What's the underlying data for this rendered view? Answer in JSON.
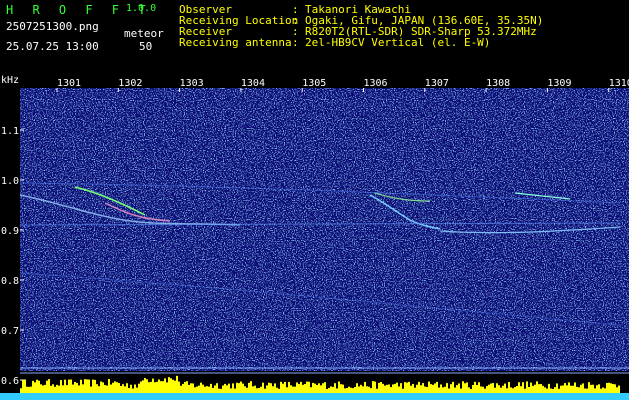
{
  "header": {
    "app_title": "H R O F F T",
    "version": "1.0.0",
    "filename": "2507251300.png",
    "datetime": "25.07.25 13:00",
    "meteor_label": "meteor",
    "meteor_count": "50",
    "info": [
      {
        "key": "Observer",
        "value": "Takanori Kawachi"
      },
      {
        "key": "Receiving Location",
        "value": "Ogaki, Gifu, JAPAN (136.60E, 35.35N)"
      },
      {
        "key": "Receiver",
        "value": "R820T2(RTL-SDR) SDR-Sharp 53.372MHz"
      },
      {
        "key": "Receiving antenna",
        "value": "2el-HB9CV Vertical (el. E-W)"
      }
    ]
  },
  "spectrogram": {
    "y_unit": "kHz",
    "y_ticks": [
      "1.1",
      "1.0",
      "0.9",
      "0.8",
      "0.7",
      "0.6"
    ],
    "x_ticks": [
      "1301",
      "1302",
      "1303",
      "1304",
      "1305",
      "1306",
      "1307",
      "1308",
      "1309",
      "1310"
    ],
    "colors": {
      "background": "#0a0a78",
      "signal": "#9cf",
      "bars": "#ff0",
      "baseline": "#3cf"
    }
  }
}
